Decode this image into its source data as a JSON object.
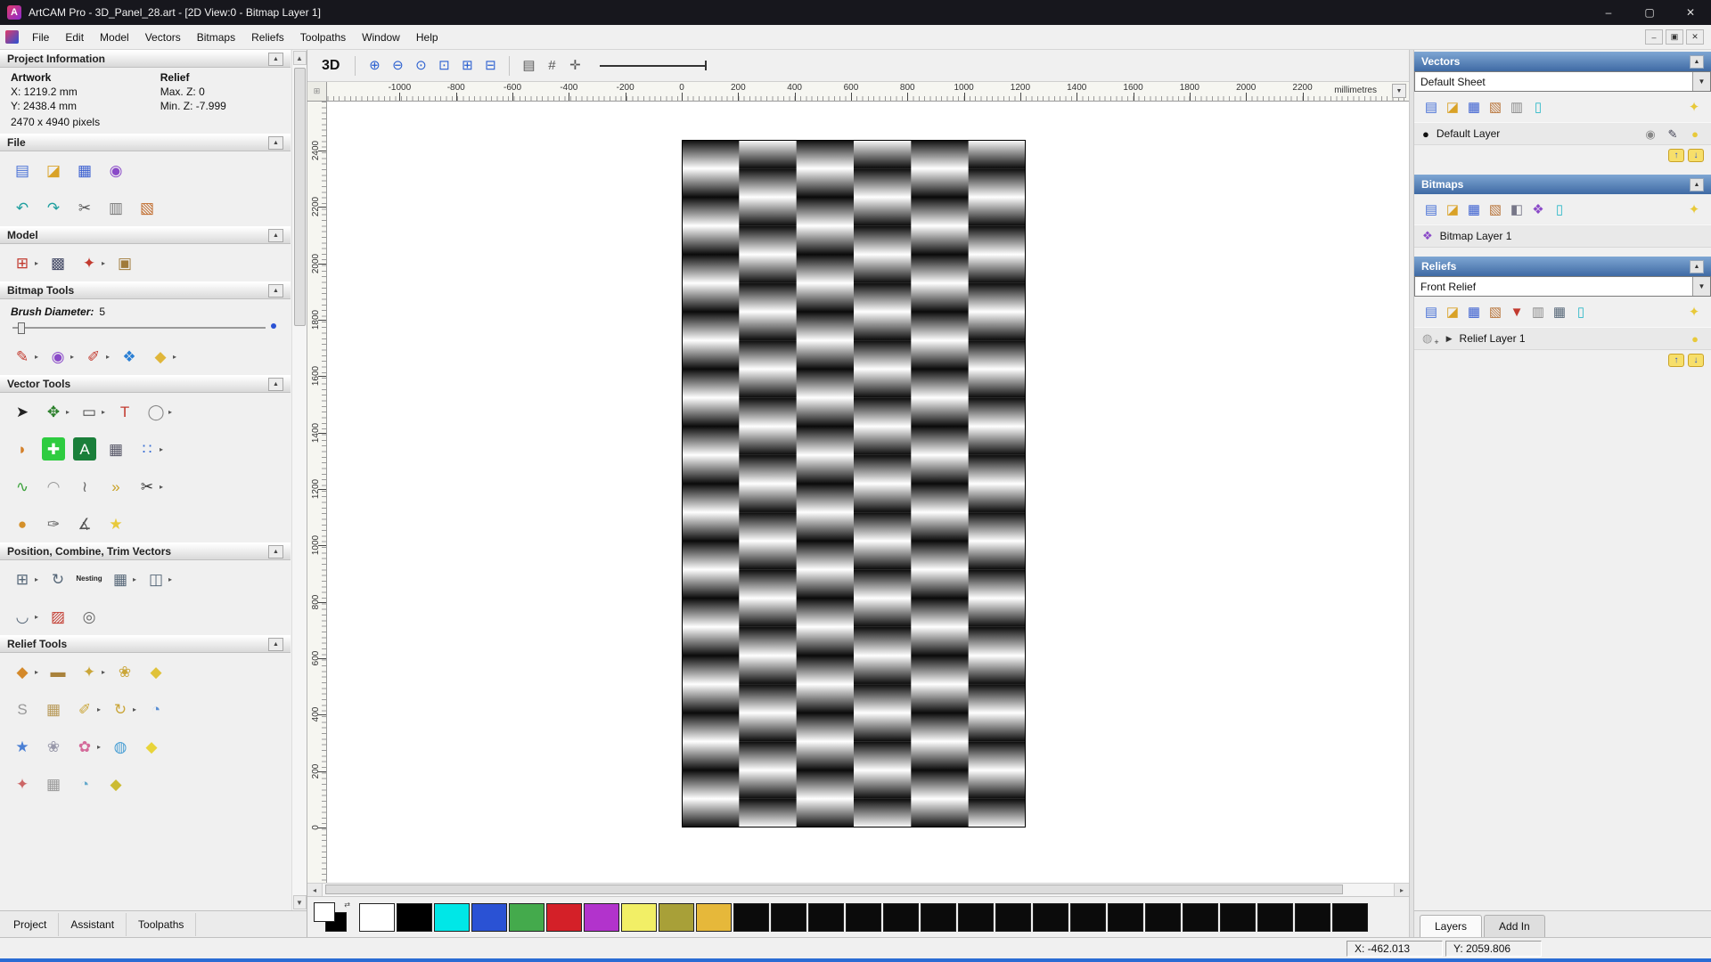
{
  "window": {
    "title": "ArtCAM Pro - 3D_Panel_28.art - [2D View:0 - Bitmap Layer 1]",
    "controls": {
      "minimize": "–",
      "maximize": "▢",
      "close": "✕"
    },
    "mdi": {
      "minimize": "–",
      "restore": "▣",
      "close": "✕"
    }
  },
  "menu": {
    "items": [
      "File",
      "Edit",
      "Model",
      "Vectors",
      "Bitmaps",
      "Reliefs",
      "Toolpaths",
      "Window",
      "Help"
    ]
  },
  "left_panel": {
    "project_information": {
      "title": "Project Information",
      "col1": "Artwork",
      "col2": "Relief",
      "r1c1": "X: 1219.2 mm",
      "r1c2": "Max. Z: 0",
      "r2c1": "Y: 2438.4 mm",
      "r2c2": "Min. Z: -7.999",
      "footer": "2470 x 4940 pixels"
    },
    "file": {
      "title": "File",
      "rows": [
        [
          {
            "name": "new-model",
            "g": "▤",
            "fg": "#4a72d6"
          },
          {
            "name": "open-model",
            "g": "◪",
            "fg": "#d9a227"
          },
          {
            "name": "save-model",
            "g": "▦",
            "fg": "#3a5fd0"
          },
          {
            "name": "model-preview",
            "g": "◉",
            "fg": "#8a4ac8"
          }
        ],
        [
          {
            "name": "undo",
            "g": "↶",
            "fg": "#1f9f9f"
          },
          {
            "name": "redo",
            "g": "↷",
            "fg": "#1f9f9f"
          },
          {
            "name": "cut",
            "g": "✂",
            "fg": "#555555"
          },
          {
            "name": "copy",
            "g": "▥",
            "fg": "#777777"
          },
          {
            "name": "paste",
            "g": "▧",
            "fg": "#c06a2a"
          }
        ]
      ]
    },
    "model": {
      "title": "Model",
      "rows": [
        [
          {
            "name": "set-model-size",
            "g": "⊞",
            "fg": "#c23a2f",
            "arrow": true
          },
          {
            "name": "adjust-model",
            "g": "▩",
            "fg": "#444a66"
          },
          {
            "name": "add-relief-clipart",
            "g": "✦",
            "fg": "#c23a2f",
            "arrow": true
          },
          {
            "name": "model-notes",
            "g": "▣",
            "fg": "#a07a3a"
          }
        ]
      ]
    },
    "bitmap_tools": {
      "title": "Bitmap Tools",
      "brush_label": "Brush Diameter:",
      "brush_value": "5",
      "rows": [
        [
          {
            "name": "paint",
            "g": "✎",
            "fg": "#c23a2f",
            "arrow": true
          },
          {
            "name": "paint-selective",
            "g": "◉",
            "fg": "#8a4ac8",
            "arrow": true
          },
          {
            "name": "draw-dots",
            "g": "✐",
            "fg": "#c23a2f",
            "arrow": true
          },
          {
            "name": "colour-palette",
            "g": "❖",
            "fg": "#2a7fd4"
          },
          {
            "name": "flood-fill",
            "g": "◆",
            "fg": "#e0b63a",
            "arrow": true
          }
        ]
      ]
    },
    "vector_tools": {
      "title": "Vector Tools",
      "rows": [
        [
          {
            "name": "select-vectors",
            "g": "➤",
            "fg": "#222222"
          },
          {
            "name": "transform-vectors",
            "g": "✥",
            "fg": "#2a7f2a",
            "arrow": true
          },
          {
            "name": "create-rectangle",
            "g": "▭",
            "fg": "#444444",
            "arrow": true
          },
          {
            "name": "create-text",
            "g": "T",
            "fg": "#c23a2f"
          },
          {
            "name": "create-ellipse",
            "g": "◯",
            "fg": "#888888",
            "arrow": true
          }
        ],
        [
          {
            "name": "offset-vector",
            "g": "◗",
            "fg": "#d4802a"
          },
          {
            "name": "create-polyline",
            "g": "✚",
            "fg": "#ffffff",
            "bg": "#2ecc40"
          },
          {
            "name": "convert-text-to-vectors",
            "g": "A",
            "fg": "#ffffff",
            "bg": "#1a7f3a"
          },
          {
            "name": "create-grid",
            "g": "▦",
            "fg": "#555566"
          },
          {
            "name": "block-paste",
            "g": "∷",
            "fg": "#3a6fd4",
            "arrow": true
          }
        ],
        [
          {
            "name": "create-freehand",
            "g": "∿",
            "fg": "#3aa23a"
          },
          {
            "name": "fit-arc",
            "g": "◠",
            "fg": "#999999"
          },
          {
            "name": "create-spline",
            "g": "≀",
            "fg": "#666666"
          },
          {
            "name": "arrow-tool",
            "g": "»",
            "fg": "#c9a227"
          },
          {
            "name": "trim-vectors",
            "g": "✂",
            "fg": "#333333",
            "arrow": true
          }
        ],
        [
          {
            "name": "create-cylinder",
            "g": "●",
            "fg": "#d4902a"
          },
          {
            "name": "node-editing",
            "g": "✑",
            "fg": "#666666"
          },
          {
            "name": "measure",
            "g": "∡",
            "fg": "#555555"
          },
          {
            "name": "wrap-star",
            "g": "★",
            "fg": "#e8c93a"
          }
        ]
      ]
    },
    "position_combine": {
      "title": "Position, Combine, Trim Vectors",
      "rows": [
        [
          {
            "name": "block-copy",
            "g": "⊞",
            "fg": "#556677",
            "arrow": true
          },
          {
            "name": "rotate-copy",
            "g": "↻",
            "fg": "#556677"
          },
          {
            "name": "nesting",
            "g": "Nesting",
            "fg": "#222222",
            "text": true
          },
          {
            "name": "align-vectors",
            "g": "▦",
            "fg": "#556677",
            "arrow": true
          },
          {
            "name": "vector-boolean",
            "g": "◫",
            "fg": "#556677",
            "arrow": true
          }
        ],
        [
          {
            "name": "fillet-tool",
            "g": "◡",
            "fg": "#556677",
            "arrow": true
          },
          {
            "name": "envelope-distort",
            "g": "▨",
            "fg": "#c23a2f"
          },
          {
            "name": "spiral",
            "g": "◎",
            "fg": "#666666"
          }
        ]
      ]
    },
    "relief_tools": {
      "title": "Relief Tools",
      "rows": [
        [
          {
            "name": "shape-editor",
            "g": "◆",
            "fg": "#d4892a",
            "arrow": true
          },
          {
            "name": "smooth-relief",
            "g": "▬",
            "fg": "#a9823c"
          },
          {
            "name": "sculpting",
            "g": "✦",
            "fg": "#caa63a",
            "arrow": true
          },
          {
            "name": "two-rail-sweep",
            "g": "❀",
            "fg": "#caa63a"
          },
          {
            "name": "extrude",
            "g": "◆",
            "fg": "#e0c23a"
          }
        ],
        [
          {
            "name": "swept-profile",
            "g": "S",
            "fg": "#999999"
          },
          {
            "name": "weave-wizard",
            "g": "▦",
            "fg": "#b89a5a"
          },
          {
            "name": "texture-relief",
            "g": "✐",
            "fg": "#caa63a",
            "arrow": true
          },
          {
            "name": "spin-relief",
            "g": "↻",
            "fg": "#caa63a",
            "arrow": true
          },
          {
            "name": "face-wizard",
            "g": "◔",
            "fg": "#5a8fd4"
          }
        ],
        [
          {
            "name": "star-wizard",
            "g": "★",
            "fg": "#4a7fd4"
          },
          {
            "name": "emboss-wizard",
            "g": "❀",
            "fg": "#9999aa"
          },
          {
            "name": "fan-wizard",
            "g": "✿",
            "fg": "#d46a9a",
            "arrow": true
          },
          {
            "name": "dome-wizard",
            "g": "◍",
            "fg": "#4a9fd4"
          },
          {
            "name": "angled-plane",
            "g": "◆",
            "fg": "#e8d43a"
          }
        ],
        [
          {
            "name": "relief-extra-1",
            "g": "✦",
            "fg": "#cc6666"
          },
          {
            "name": "relief-extra-2",
            "g": "▦",
            "fg": "#999999"
          },
          {
            "name": "relief-extra-3",
            "g": "◔",
            "fg": "#66aacc"
          },
          {
            "name": "relief-extra-4",
            "g": "◆",
            "fg": "#ccbb33"
          }
        ]
      ]
    },
    "tabs": [
      "Project",
      "Assistant",
      "Toolpaths"
    ]
  },
  "canvas": {
    "toolbar": {
      "view3d": "3D",
      "group1": [
        {
          "name": "zoom-in",
          "g": "⊕",
          "fg": "#2a5fd0"
        },
        {
          "name": "zoom-out",
          "g": "⊖",
          "fg": "#2a5fd0"
        },
        {
          "name": "zoom-previous",
          "g": "⊙",
          "fg": "#2a5fd0"
        }
      ],
      "group2": [
        {
          "name": "zoom-window",
          "g": "⊡",
          "fg": "#2a5fd0"
        },
        {
          "name": "zoom-sheet",
          "g": "⊞",
          "fg": "#2a5fd0"
        },
        {
          "name": "zoom-objects",
          "g": "⊟",
          "fg": "#2a5fd0"
        }
      ],
      "group3": [
        {
          "name": "print-preview",
          "g": "▤",
          "fg": "#555555"
        },
        {
          "name": "snap-toggle",
          "g": "#",
          "fg": "#555555"
        },
        {
          "name": "pan-view",
          "g": "✛",
          "fg": "#555555"
        }
      ]
    },
    "ruler": {
      "h_ticks": [
        -1000,
        -800,
        -600,
        -400,
        -200,
        0,
        200,
        400,
        600,
        800,
        1000,
        1200,
        1400,
        1600,
        1800,
        2000,
        2200
      ],
      "v_ticks": [
        0,
        200,
        400,
        600,
        800,
        1000,
        1200,
        1400,
        1600,
        1800,
        2000,
        2200,
        2400
      ],
      "unit": "millimetres"
    }
  },
  "right_panel": {
    "vectors": {
      "title": "Vectors",
      "sheet": "Default Sheet",
      "toolbar": [
        {
          "name": "new-vector-layer",
          "g": "▤",
          "fg": "#4a72d6"
        },
        {
          "name": "open-vector-layer",
          "g": "◪",
          "fg": "#d9a227"
        },
        {
          "name": "save-vector-layer",
          "g": "▦",
          "fg": "#3a5fd0"
        },
        {
          "name": "import-vectors",
          "g": "▧",
          "fg": "#b8743a"
        },
        {
          "name": "export-vectors",
          "g": "▥",
          "fg": "#888888"
        },
        {
          "name": "delete-vector-layer",
          "g": "▯",
          "fg": "#2ab8c8"
        }
      ],
      "toolbar_right": [
        {
          "name": "toggle-all-vectors",
          "g": "✦",
          "fg": "#e8c93a"
        }
      ],
      "layer_bullet": "●",
      "layer_name": "Default Layer",
      "layer_icons": [
        {
          "name": "snap-lock",
          "g": "◉",
          "fg": "#888888"
        },
        {
          "name": "edit-layer",
          "g": "✎",
          "fg": "#444455"
        },
        {
          "name": "layer-visibility",
          "g": "●",
          "fg": "#e8c93a"
        }
      ]
    },
    "bitmaps": {
      "title": "Bitmaps",
      "toolbar": [
        {
          "name": "new-bitmap-layer",
          "g": "▤",
          "fg": "#4a72d6"
        },
        {
          "name": "open-bitmap-layer",
          "g": "◪",
          "fg": "#d9a227"
        },
        {
          "name": "save-bitmap-layer",
          "g": "▦",
          "fg": "#3a5fd0"
        },
        {
          "name": "import-bitmap",
          "g": "▧",
          "fg": "#b8743a"
        },
        {
          "name": "merge-bitmap",
          "g": "◧",
          "fg": "#777788"
        },
        {
          "name": "convert-bitmap",
          "g": "❖",
          "fg": "#8a4ac8"
        },
        {
          "name": "delete-bitmap-layer",
          "g": "▯",
          "fg": "#2ab8c8"
        }
      ],
      "toolbar_right": [
        {
          "name": "toggle-all-bitmaps",
          "g": "✦",
          "fg": "#e8c93a"
        }
      ],
      "layer_icon": "❖",
      "layer_name": "Bitmap Layer 1"
    },
    "reliefs": {
      "title": "Reliefs",
      "select": "Front Relief",
      "toolbar": [
        {
          "name": "new-relief-layer",
          "g": "▤",
          "fg": "#4a72d6"
        },
        {
          "name": "open-relief-layer",
          "g": "◪",
          "fg": "#d9a227"
        },
        {
          "name": "save-relief-layer",
          "g": "▦",
          "fg": "#3a5fd0"
        },
        {
          "name": "import-relief",
          "g": "▧",
          "fg": "#b8743a"
        },
        {
          "name": "load-relief",
          "g": "▼",
          "fg": "#c23a2f"
        },
        {
          "name": "duplicate-relief",
          "g": "▥",
          "fg": "#888888"
        },
        {
          "name": "relief-grid",
          "g": "▦",
          "fg": "#556677"
        },
        {
          "name": "delete-relief-layer",
          "g": "▯",
          "fg": "#2ab8c8"
        }
      ],
      "toolbar_right": [
        {
          "name": "toggle-all-reliefs",
          "g": "✦",
          "fg": "#e8c93a"
        }
      ],
      "layer_name": "Relief Layer 1",
      "layer_visibility_glyph": "●"
    },
    "tabs": [
      "Layers",
      "Add In"
    ]
  },
  "palette": {
    "colors": [
      "#ffffff",
      "#000000",
      "#00e7e7",
      "#2a52d4",
      "#44aa4c",
      "#d42028",
      "#b233cc",
      "#f2ef66",
      "#a8a038",
      "#e6b83a",
      "#0b0b0b",
      "#0b0b0b",
      "#0b0b0b",
      "#0b0b0b",
      "#0b0b0b",
      "#0b0b0b",
      "#0b0b0b",
      "#0b0b0b",
      "#0b0b0b",
      "#0b0b0b",
      "#0b0b0b",
      "#0b0b0b",
      "#0b0b0b",
      "#0b0b0b",
      "#0b0b0b",
      "#0b0b0b",
      "#0b0b0b"
    ]
  },
  "status": {
    "x": "X: -462.013",
    "y": "Y: 2059.806"
  }
}
